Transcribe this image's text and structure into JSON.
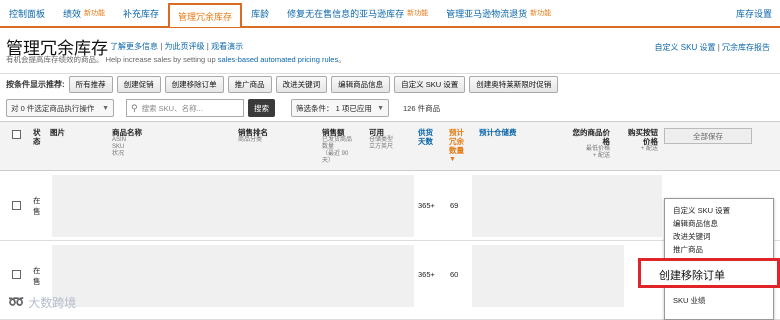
{
  "tabs": [
    {
      "label": "控制面板",
      "badge": ""
    },
    {
      "label": "绩效",
      "badge": "新功能"
    },
    {
      "label": "补充库存",
      "badge": ""
    },
    {
      "label": "管理冗余库存",
      "badge": ""
    },
    {
      "label": "库龄",
      "badge": ""
    },
    {
      "label": "修复无在售信息的亚马逊库存",
      "badge": "新功能"
    },
    {
      "label": "管理亚马逊物流退货",
      "badge": "新功能"
    }
  ],
  "tab_right": "库存设置",
  "page": {
    "title": "管理冗余库存",
    "link_learn_more": "了解更多信息",
    "link_rate": "为此页评级",
    "link_demo": "观看演示",
    "subtitle_prefix": "有机会提高库存绩效的商品。 Help increase sales by setting up ",
    "subtitle_link": "sales-based automated pricing rules",
    "subtitle_suffix": "。",
    "link_custom_sku": "自定义 SKU 设置",
    "link_report": "冗余库存报告"
  },
  "filters": {
    "label": "按条件显示推荐:",
    "buttons": [
      "所有推荐",
      "创建促销",
      "创建移除订单",
      "推广商品",
      "改进关键词",
      "编辑商品信息",
      "自定义 SKU 设置",
      "创建奥特莱斯限时促销"
    ]
  },
  "toolbar": {
    "bulk_action": "对 0 件选定商品执行操作",
    "search_placeholder": "搜索 SKU、名称...",
    "search_button": "搜索",
    "filter_condition": "筛选条件： 1 项已应用",
    "item_count": "126 件商品"
  },
  "table": {
    "headers": {
      "status": "状态",
      "image": "图片",
      "product_name": "商品名称",
      "product_name_sub": [
        "ASIN",
        "SKU",
        "状况"
      ],
      "sales_rank": "销售排名",
      "sales_rank_sub": [
        "商品分类"
      ],
      "sales": "销售额",
      "sales_sub": [
        "已发货商品",
        "数量",
        "（最近 90",
        "天）"
      ],
      "available": "可用",
      "available_sub": [
        "仓储类型",
        "立方英尺"
      ],
      "supply_days": "供货天数",
      "estimated_excess": "预计冗余数量",
      "estimated_fee": "预计仓储费",
      "your_price": "您的商品价格",
      "your_price_sub": [
        "最低价格",
        "+ 配送"
      ],
      "buybox": "购买按钮价格",
      "buybox_sub": [
        "+ 配送"
      ],
      "save_all": "全部保存"
    },
    "rows": [
      {
        "status": "在售",
        "supply_days": "365+",
        "excess": "69"
      },
      {
        "status": "在售",
        "supply_days": "365+",
        "excess": "60"
      }
    ]
  },
  "menu": {
    "items": [
      "自定义 SKU 设置",
      "编辑商品信息",
      "改进关键词",
      "推广商品"
    ],
    "highlighted": "创建移除订单",
    "last": "SKU 业绩"
  },
  "watermark": {
    "text": "大数跨境"
  },
  "colors": {
    "accent": "#e47911",
    "link": "#0b66a8",
    "highlight": "#e0252a"
  }
}
